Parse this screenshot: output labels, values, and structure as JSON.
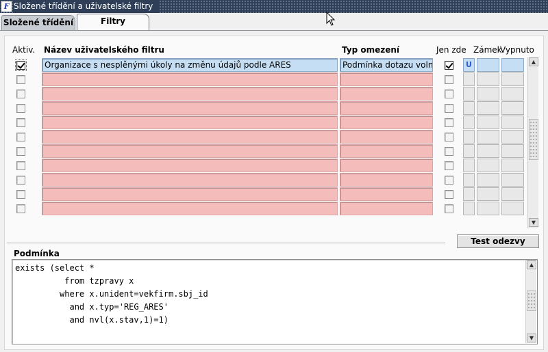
{
  "window": {
    "title": "Složené třídění a uživatelské filtry",
    "icon": "application-icon"
  },
  "tabs": [
    {
      "label": "Složené třídění",
      "active": false
    },
    {
      "label": "Filtry",
      "active": true
    }
  ],
  "grid": {
    "headers": {
      "aktiv": "Aktiv.",
      "name": "Název uživatelského filtru",
      "type": "Typ omezení",
      "jen_zde": "Jen zde",
      "zamek": "Zámek",
      "vypnuto": "Vypnuto"
    },
    "rows": [
      {
        "aktiv": true,
        "name": "Organizace s nesplěnými úkoly na změnu údajů podle ARES",
        "type": "Podmínka dotazu volne",
        "jen_zde": true,
        "zamek": "U"
      },
      {
        "aktiv": false,
        "name": "",
        "type": "",
        "jen_zde": false,
        "zamek": ""
      },
      {
        "aktiv": false,
        "name": "",
        "type": "",
        "jen_zde": false,
        "zamek": ""
      },
      {
        "aktiv": false,
        "name": "",
        "type": "",
        "jen_zde": false,
        "zamek": ""
      },
      {
        "aktiv": false,
        "name": "",
        "type": "",
        "jen_zde": false,
        "zamek": ""
      },
      {
        "aktiv": false,
        "name": "",
        "type": "",
        "jen_zde": false,
        "zamek": ""
      },
      {
        "aktiv": false,
        "name": "",
        "type": "",
        "jen_zde": false,
        "zamek": ""
      },
      {
        "aktiv": false,
        "name": "",
        "type": "",
        "jen_zde": false,
        "zamek": ""
      },
      {
        "aktiv": false,
        "name": "",
        "type": "",
        "jen_zde": false,
        "zamek": ""
      },
      {
        "aktiv": false,
        "name": "",
        "type": "",
        "jen_zde": false,
        "zamek": ""
      },
      {
        "aktiv": false,
        "name": "",
        "type": "",
        "jen_zde": false,
        "zamek": ""
      }
    ]
  },
  "test_button": "Test odezvy",
  "condition": {
    "label": "Podmínka",
    "text": "exists (select *\n          from tzpravy x\n         where x.unident=vekfirm.sbj_id\n           and x.typ='REG_ARES'\n           and nvl(x.stav,1)=1)"
  },
  "colors": {
    "row_active": "#c6def3",
    "row_required": "#f5bcbc",
    "titlebar": "#2e3f57"
  }
}
